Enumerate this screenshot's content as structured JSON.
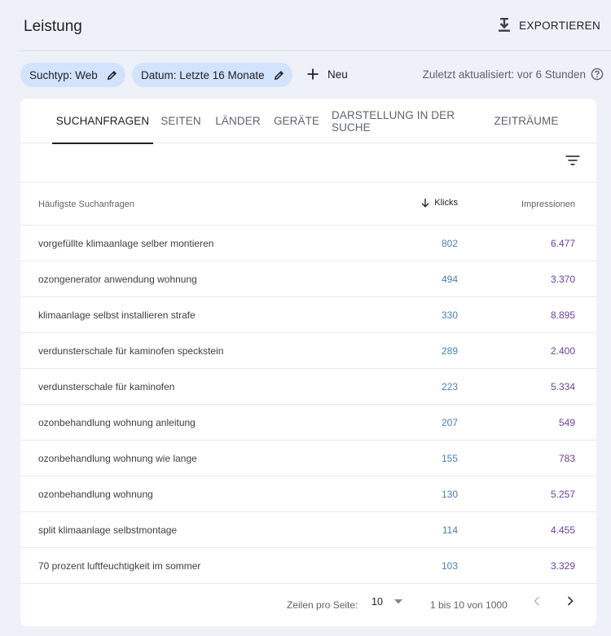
{
  "header": {
    "title": "Leistung",
    "export_label": "EXPORTIEREN"
  },
  "filters": {
    "search_type": "Suchtyp: Web",
    "date": "Datum: Letzte 16 Monate",
    "new_label": "Neu",
    "last_updated": "Zuletzt aktualisiert: vor 6 Stunden"
  },
  "tabs": [
    {
      "label": "SUCHANFRAGEN",
      "active": true
    },
    {
      "label": "SEITEN",
      "active": false
    },
    {
      "label": "LÄNDER",
      "active": false
    },
    {
      "label": "GERÄTE",
      "active": false
    },
    {
      "label": "DARSTELLUNG IN DER SUCHE",
      "active": false
    },
    {
      "label": "ZEITRÄUME",
      "active": false
    }
  ],
  "table": {
    "columns": {
      "query": "Häufigste Suchanfragen",
      "clicks": "Klicks",
      "impressions": "Impressionen"
    },
    "rows": [
      {
        "query": "vorgefüllte klimaanlage selber montieren",
        "clicks": "802",
        "impressions": "6.477"
      },
      {
        "query": "ozongenerator anwendung wohnung",
        "clicks": "494",
        "impressions": "3.370"
      },
      {
        "query": "klimaanlage selbst installieren strafe",
        "clicks": "330",
        "impressions": "8.895"
      },
      {
        "query": "verdunsterschale für kaminofen speckstein",
        "clicks": "289",
        "impressions": "2.400"
      },
      {
        "query": "verdunsterschale für kaminofen",
        "clicks": "223",
        "impressions": "5.334"
      },
      {
        "query": "ozonbehandlung wohnung anleitung",
        "clicks": "207",
        "impressions": "549"
      },
      {
        "query": "ozonbehandlung wohnung wie lange",
        "clicks": "155",
        "impressions": "783"
      },
      {
        "query": "ozonbehandlung wohnung",
        "clicks": "130",
        "impressions": "5.257"
      },
      {
        "query": "split klimaanlage selbstmontage",
        "clicks": "114",
        "impressions": "4.455"
      },
      {
        "query": "70 prozent luftfeuchtigkeit im sommer",
        "clicks": "103",
        "impressions": "3.329"
      }
    ]
  },
  "pagination": {
    "rows_per_page_label": "Zeilen pro Seite:",
    "rows_per_page": "10",
    "range": "1 bis 10 von 1000"
  },
  "colors": {
    "chip_bg": "#d3e3fd",
    "clicks": "#4a7ebb",
    "impressions": "#6b3fa0",
    "page_bg": "#eef1f7"
  }
}
